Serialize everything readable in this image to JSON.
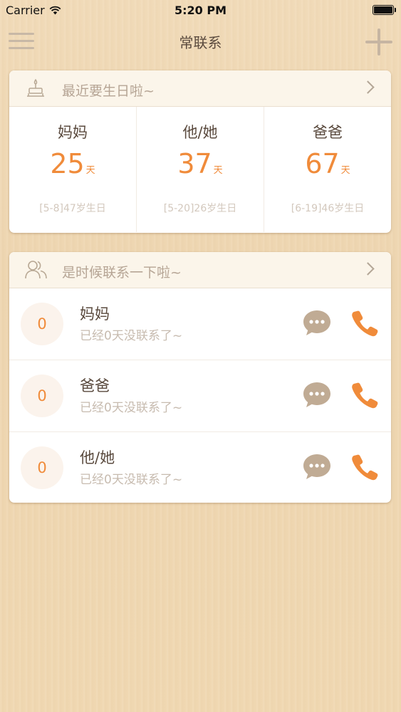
{
  "status_bar": {
    "carrier": "Carrier",
    "time": "5:20 PM"
  },
  "nav": {
    "title": "常联系"
  },
  "birthday_card": {
    "header": "最近要生日啦~",
    "items": [
      {
        "name": "妈妈",
        "days": "25",
        "unit": "天",
        "date": "[5-8]47岁生日"
      },
      {
        "name": "他/她",
        "days": "37",
        "unit": "天",
        "date": "[5-20]26岁生日"
      },
      {
        "name": "爸爸",
        "days": "67",
        "unit": "天",
        "date": "[6-19]46岁生日"
      }
    ]
  },
  "contact_card": {
    "header": "是时候联系一下啦~",
    "items": [
      {
        "count": "0",
        "name": "妈妈",
        "status": "已经0天没联系了~"
      },
      {
        "count": "0",
        "name": "爸爸",
        "status": "已经0天没联系了~"
      },
      {
        "count": "0",
        "name": "他/她",
        "status": "已经0天没联系了~"
      }
    ]
  },
  "colors": {
    "accent": "#f08b3a",
    "icon_muted": "#b8a894"
  },
  "icons": [
    "menu-icon",
    "add-icon",
    "cake-icon",
    "people-icon",
    "chevron-right-icon",
    "message-icon",
    "phone-icon",
    "wifi-icon",
    "battery-icon"
  ]
}
